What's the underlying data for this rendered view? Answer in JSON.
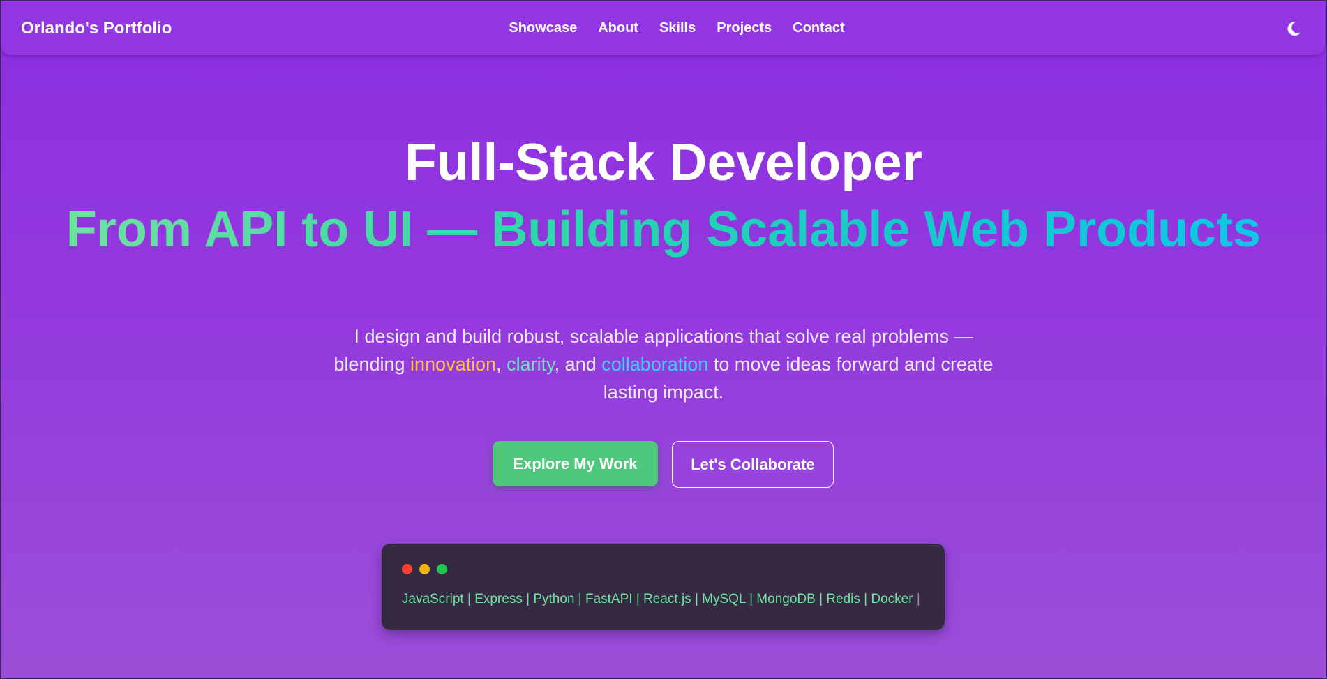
{
  "nav": {
    "brand": "Orlando's Portfolio",
    "links": [
      "Showcase",
      "About",
      "Skills",
      "Projects",
      "Contact"
    ],
    "theme_icon": "moon-icon"
  },
  "hero": {
    "title": "Full-Stack Developer",
    "subtitle": "From API to UI — Building Scalable Web Products",
    "desc_part1": "I design and build robust, scalable applications that solve real problems — blending ",
    "keyword_innovation": "innovation",
    "sep1": ", ",
    "keyword_clarity": "clarity",
    "sep2": ", and ",
    "keyword_collaboration": "collaboration",
    "desc_part2": " to move ideas forward and create lasting impact."
  },
  "buttons": {
    "primary": "Explore My Work",
    "secondary": "Let's Collaborate"
  },
  "terminal": {
    "text": "JavaScript | Express | Python | FastAPI | React.js | MySQL | MongoDB | Redis | Docker",
    "cursor": "|"
  },
  "colors": {
    "background": "#8b2fe0",
    "accent_green": "#4ec87a",
    "innovation": "#ffc23d",
    "clarity": "#6fe1c4",
    "collaboration": "#3ed1ff",
    "terminal_bg": "#352a42"
  }
}
